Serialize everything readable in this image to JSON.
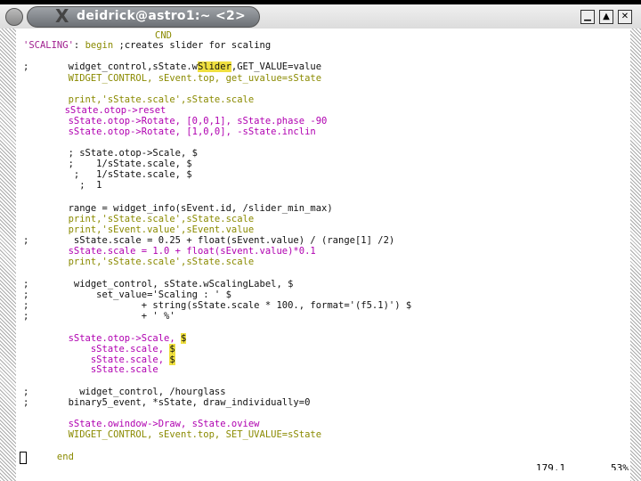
{
  "window": {
    "title": "deidrick@astro1:~ <2>"
  },
  "status": {
    "position": "179,1",
    "percent": "53%"
  },
  "code": {
    "l0": "CND",
    "l1a": "'SCALING'",
    "l1b": ": ",
    "l1c": "begin",
    "l1d": " ;creates slider for scaling",
    "l2a": ";       widget_control,sState.w",
    "l2b": "Slider",
    "l2c": ",GET_VALUE=value",
    "l3": "        WIDGET_CONTROL, sEvent.top, get_uvalue=sState",
    "l4": "        print,'sState.scale',sState.scale",
    "l5": "        sState.otop->reset",
    "l6": "        sState.otop->Rotate, [0,0,1], sState.phase -90",
    "l7": "        sState.otop->Rotate, [1,0,0], -sState.inclin",
    "l8": "        ; sState.otop->Scale, $",
    "l9": "        ;    1/sState.scale, $",
    "l10": "         ;   1/sState.scale, $",
    "l11": "          ;  1",
    "l12": "        range = widget_info(sEvent.id, /slider_min_max)",
    "l13": "        print,'sState.scale',sState.scale",
    "l14": "        print,'sEvent.value',sEvent.value",
    "l15": ";        sState.scale = 0.25 + float(sEvent.value) / (range[1] /2)",
    "l16": "        sState.scale = 1.0 + float(sEvent.value)*0.1",
    "l17": "        print,'sState.scale',sState.scale",
    "l18": ";        widget_control, sState.wScalingLabel, $",
    "l19": ";            set_value='Scaling : ' $",
    "l20": ";                    + string(sState.scale * 100., format='(f5.1)') $",
    "l21": ";                    + ' %'",
    "l22a": "        sState.otop->Scale, ",
    "l22b": "$",
    "l23a": "            sState.scale, ",
    "l23b": "$",
    "l24a": "            sState.scale, ",
    "l24b": "$",
    "l25": "            sState.scale",
    "l26": ";         widget_control, /hourglass",
    "l27": ";       binary5_event, *sState, draw_individually=0",
    "l28": "        sState.owindow->Draw, sState.oview",
    "l29": "        WIDGET_CONTROL, sEvent.top, SET_UVALUE=sState",
    "l30": "      end"
  }
}
